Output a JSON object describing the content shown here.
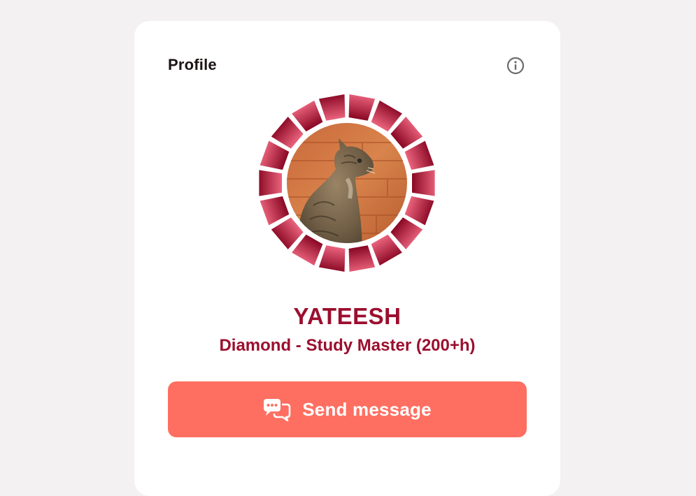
{
  "profile": {
    "title": "Profile",
    "info_icon": "info-icon",
    "avatar": {
      "subject": "tabby cat photo",
      "badge_frame": "diamond-rank-ring"
    },
    "user_name": "YATEESH",
    "rank": "Diamond - Study Master (200+h)",
    "send_message_label": "Send message",
    "send_message_icon": "chat-bubbles-icon"
  },
  "colors": {
    "background": "#f3f1f1",
    "card": "#ffffff",
    "accent_text": "#9b0f2e",
    "button": "#fe6f61",
    "button_text": "#ffffff",
    "ring_light": "#e8607a",
    "ring_dark": "#8c0a26"
  }
}
